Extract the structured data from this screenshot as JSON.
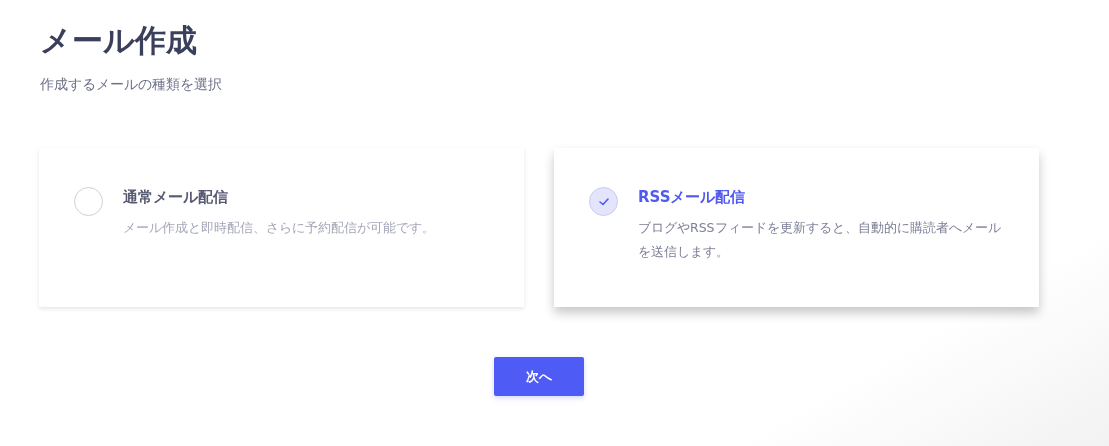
{
  "header": {
    "title": "メール作成",
    "subtitle": "作成するメールの種類を選択"
  },
  "options": [
    {
      "title": "通常メール配信",
      "description": "メール作成と即時配信、さらに予約配信が可能です。",
      "selected": false
    },
    {
      "title": "RSSメール配信",
      "description": "ブログやRSSフィードを更新すると、自動的に購読者へメールを送信します。",
      "selected": true
    }
  ],
  "next_button": "次へ"
}
